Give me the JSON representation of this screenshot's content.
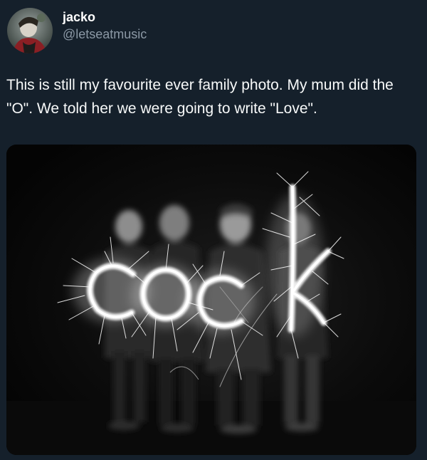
{
  "author": {
    "display_name": "jacko",
    "handle": "@letseatmusic"
  },
  "tweet": {
    "text": "This is still my favourite ever family photo. My mum did the \"O\". We told her we were going to write \"Love\"."
  },
  "media": {
    "description_icon": "sparkler-writing-photo",
    "sparkler_word": "cock"
  },
  "colors": {
    "background": "#15202b",
    "primary_text": "#f7f9f9",
    "secondary_text": "#8b98a5"
  }
}
